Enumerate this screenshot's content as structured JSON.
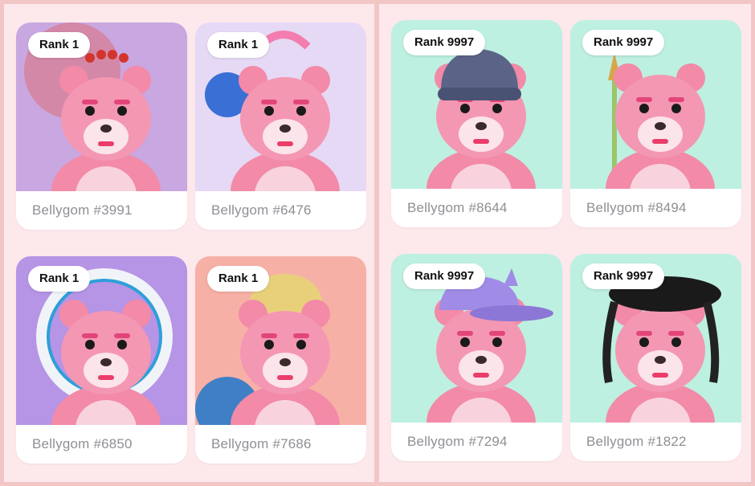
{
  "collections": [
    {
      "panel": "left",
      "items": [
        {
          "rank": "Rank 1",
          "name": "Bellygom #3991",
          "bg": "#c9a7e0",
          "accent": "#e84f3c"
        },
        {
          "rank": "Rank 1",
          "name": "Bellygom #6476",
          "bg": "#e6d9f5",
          "accent": "#8fd6e6"
        },
        {
          "rank": "Rank 1",
          "name": "Bellygom #6850",
          "bg": "#b694e6",
          "accent": "#2e9fd8"
        },
        {
          "rank": "Rank 1",
          "name": "Bellygom #7686",
          "bg": "#f7b0a6",
          "accent": "#e8d07a"
        }
      ]
    },
    {
      "panel": "right",
      "items": [
        {
          "rank": "Rank 9997",
          "name": "Bellygom #8644",
          "bg": "#bdf0e1",
          "accent": "#5b6487"
        },
        {
          "rank": "Rank 9997",
          "name": "Bellygom #8494",
          "bg": "#bdf0e1",
          "accent": "#d8a64a"
        },
        {
          "rank": "Rank 9997",
          "name": "Bellygom #7294",
          "bg": "#bdf0e1",
          "accent": "#a08ce6"
        },
        {
          "rank": "Rank 9997",
          "name": "Bellygom #1822",
          "bg": "#bdf0e1",
          "accent": "#1a1a1a"
        }
      ]
    }
  ]
}
